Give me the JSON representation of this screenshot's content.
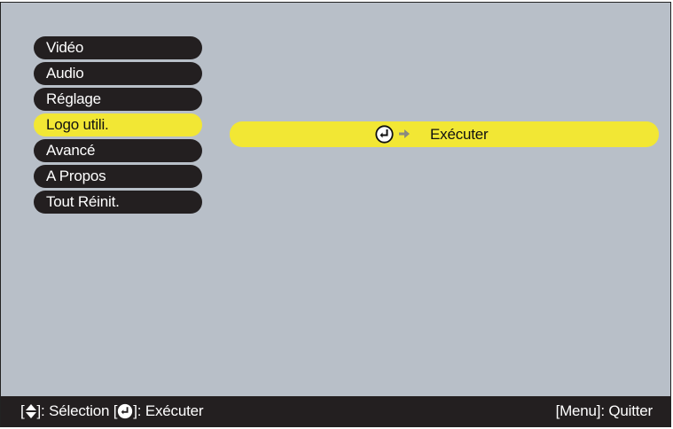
{
  "menu": {
    "items": [
      {
        "label": "Vidéo"
      },
      {
        "label": "Audio"
      },
      {
        "label": "Réglage"
      },
      {
        "label": "Logo utili."
      },
      {
        "label": "Avancé"
      },
      {
        "label": "A Propos"
      },
      {
        "label": "Tout Réinit."
      }
    ],
    "active_index": 3
  },
  "submenu": {
    "action_label": "Exécuter",
    "icons": [
      "enter-icon",
      "arrow-right-icon"
    ]
  },
  "footer": {
    "bracket_open_1": "[",
    "selection_label": "]: Sélection [",
    "execute_label": "]: Exécuter",
    "quit_label": "[Menu]: Quitter",
    "icons": [
      "up-down-arrow-icon",
      "enter-icon"
    ]
  },
  "colors": {
    "background": "#b8bfc8",
    "menu_item": "#231f20",
    "highlight": "#f2e734",
    "footer": "#231f20"
  }
}
